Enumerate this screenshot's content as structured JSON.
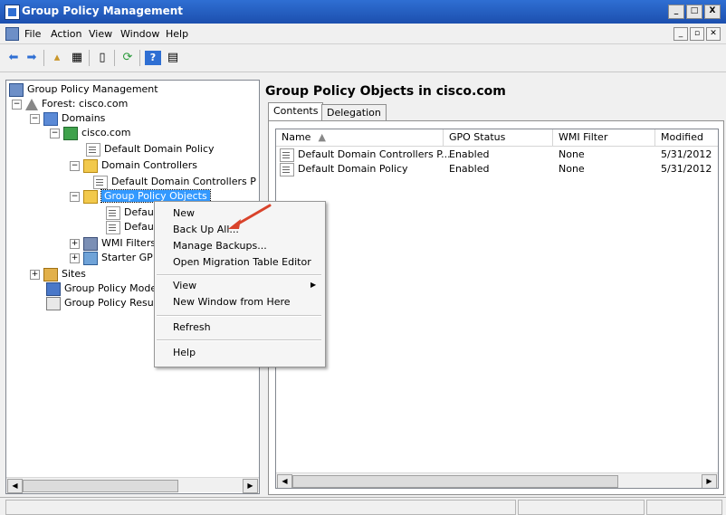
{
  "window": {
    "title": "Group Policy Management"
  },
  "menubar": {
    "items": [
      "File",
      "Action",
      "View",
      "Window",
      "Help"
    ]
  },
  "toolbar": {
    "icons": [
      "back-icon",
      "forward-icon",
      "up-icon",
      "show-hide-tree-icon",
      "properties-icon",
      "refresh-icon",
      "help-icon",
      "export-icon"
    ]
  },
  "tree": {
    "root": "Group Policy Management",
    "forest": "Forest: cisco.com",
    "domains": "Domains",
    "domain": "cisco.com",
    "default_domain_policy": "Default Domain Policy",
    "domain_controllers": "Domain Controllers",
    "default_dc_policy": "Default Domain Controllers P",
    "gpo_folder": "Group Policy Objects",
    "gpo_child_1": "Defaul",
    "gpo_child_2": "Defaul",
    "wmi_filters": "WMI Filters",
    "starter_gpos": "Starter GP",
    "sites": "Sites",
    "modeling": "Group Policy Mode",
    "results": "Group Policy Resul"
  },
  "right_pane": {
    "heading": "Group Policy Objects in cisco.com",
    "tabs": [
      "Contents",
      "Delegation"
    ],
    "columns": [
      "Name",
      "GPO Status",
      "WMI Filter",
      "Modified"
    ],
    "rows": [
      {
        "name": "Default Domain Controllers P...",
        "status": "Enabled",
        "wmi": "None",
        "modified": "5/31/2012"
      },
      {
        "name": "Default Domain Policy",
        "status": "Enabled",
        "wmi": "None",
        "modified": "5/31/2012"
      }
    ]
  },
  "context_menu": {
    "items": [
      "New",
      "Back Up All...",
      "Manage Backups...",
      "Open Migration Table Editor",
      "View",
      "New Window from Here",
      "Refresh",
      "Help"
    ]
  },
  "colors": {
    "titlebar": "#1c4fae",
    "selection": "#3399ff",
    "arrow": "#d9432b"
  }
}
